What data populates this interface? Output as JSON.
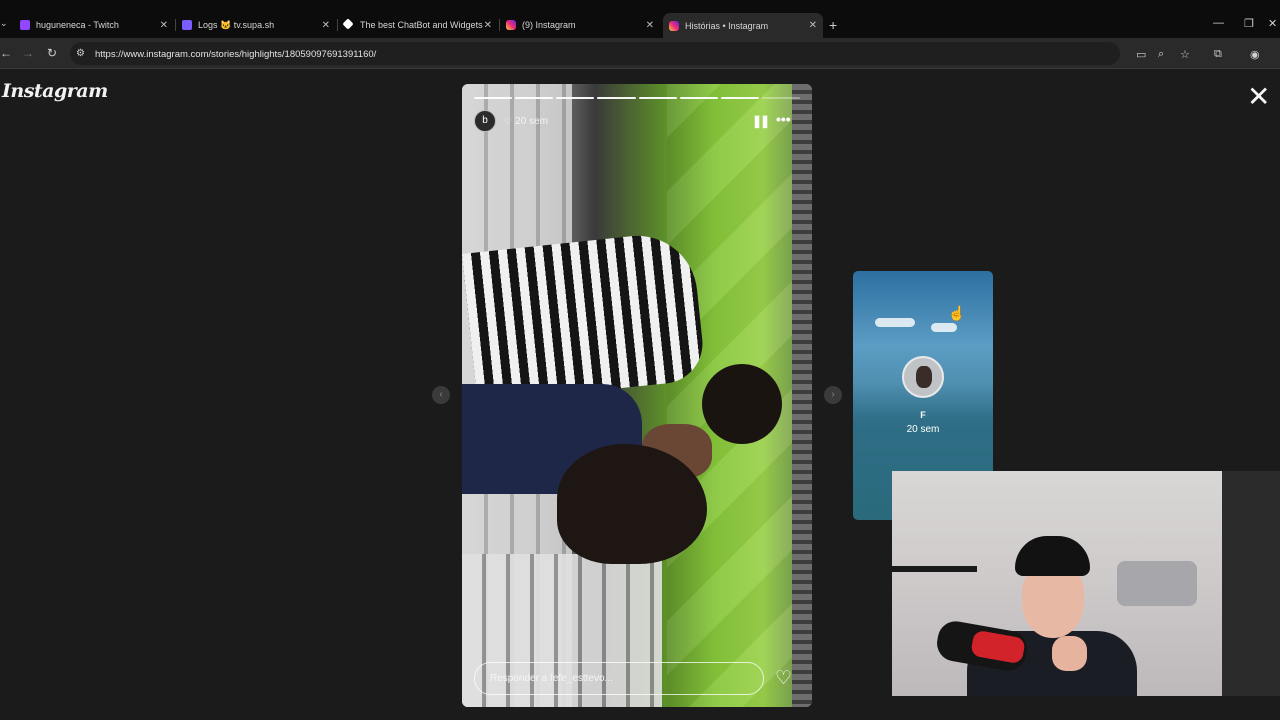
{
  "browser": {
    "tabs": [
      {
        "title": "huguneneca - Twitch",
        "favicon_color": "#9146ff",
        "active": false
      },
      {
        "title": "Logs 🐱 tv.supa.sh",
        "favicon_color": "#7b5cff",
        "active": false
      },
      {
        "title": "The best ChatBot and Widgets",
        "favicon_color": "#ffffff",
        "active": false
      },
      {
        "title": "(9) Instagram",
        "favicon_color": "#e1306c",
        "active": false
      },
      {
        "title": "Histórias • Instagram",
        "favicon_color": "#e1306c",
        "active": true
      }
    ],
    "new_tab_glyph": "+",
    "url": "https://www.instagram.com/stories/highlights/18059097691391160/"
  },
  "instagram": {
    "logo": "Instagram",
    "close_glyph": "✕",
    "story": {
      "progress_segments": 8,
      "progress_completed": 7,
      "avatar_letter": "b",
      "time": "20 sem",
      "reply_placeholder": "Responder a fefe_esttevo..."
    },
    "next_story": {
      "name": "F",
      "time": "20 sem"
    }
  },
  "colors": {
    "page_bg": "#1b1b1b",
    "tabstrip_bg": "#0c0c0c",
    "toolbar_bg": "#2a2a2a"
  }
}
